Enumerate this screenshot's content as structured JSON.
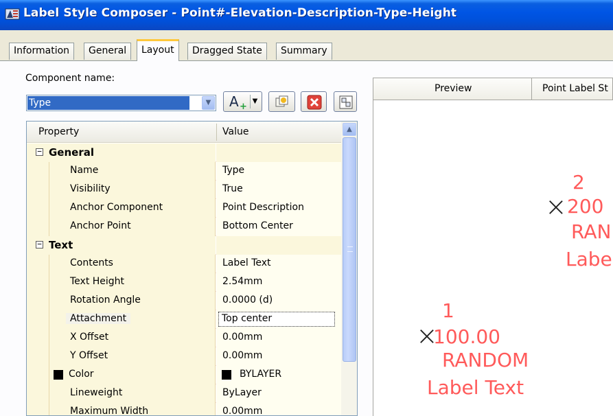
{
  "window": {
    "title": "Label Style Composer - Point#-Elevation-Description-Type-Height"
  },
  "tabs": [
    {
      "label": "Information",
      "active": false
    },
    {
      "label": "General",
      "active": false
    },
    {
      "label": "Layout",
      "active": true
    },
    {
      "label": "Dragged State",
      "active": false
    },
    {
      "label": "Summary",
      "active": false
    }
  ],
  "component": {
    "label": "Component name:",
    "selected": "Type"
  },
  "toolbar": {
    "icons": [
      "add-text-component-icon",
      "dropdown-arrow-icon",
      "copy-component-icon",
      "delete-component-icon",
      "component-draw-order-icon"
    ]
  },
  "grid": {
    "header": {
      "property": "Property",
      "value": "Value"
    },
    "categories": [
      {
        "name": "General",
        "rows": [
          {
            "property": "Name",
            "value": "Type"
          },
          {
            "property": "Visibility",
            "value": "True"
          },
          {
            "property": "Anchor Component",
            "value": "Point Description"
          },
          {
            "property": "Anchor Point",
            "value": "Bottom Center"
          }
        ]
      },
      {
        "name": "Text",
        "rows": [
          {
            "property": "Contents",
            "value": "Label Text"
          },
          {
            "property": "Text Height",
            "value": "2.54mm"
          },
          {
            "property": "Rotation Angle",
            "value": "0.0000 (d)"
          },
          {
            "property": "Attachment",
            "value": "Top center"
          },
          {
            "property": "X Offset",
            "value": "0.00mm"
          },
          {
            "property": "Y Offset",
            "value": "0.00mm"
          },
          {
            "property": "Color",
            "value": "BYLAYER"
          },
          {
            "property": "Lineweight",
            "value": "ByLayer"
          },
          {
            "property": "Maximum Width",
            "value": "0.00mm"
          }
        ]
      }
    ],
    "toggle_symbol": "−",
    "colors": {
      "swatch": "#000000",
      "selection": "#316ac5"
    }
  },
  "preview": {
    "tab_label": "Preview",
    "style_label": "Point Label St",
    "marker": "×",
    "label_color": "#ff5a5a",
    "points": [
      {
        "number": "1",
        "elevation": "100.00",
        "description": "RANDOM",
        "type": "Label Text"
      },
      {
        "number": "2",
        "elevation": "200",
        "description": "RAN",
        "type": "Labe"
      }
    ]
  }
}
